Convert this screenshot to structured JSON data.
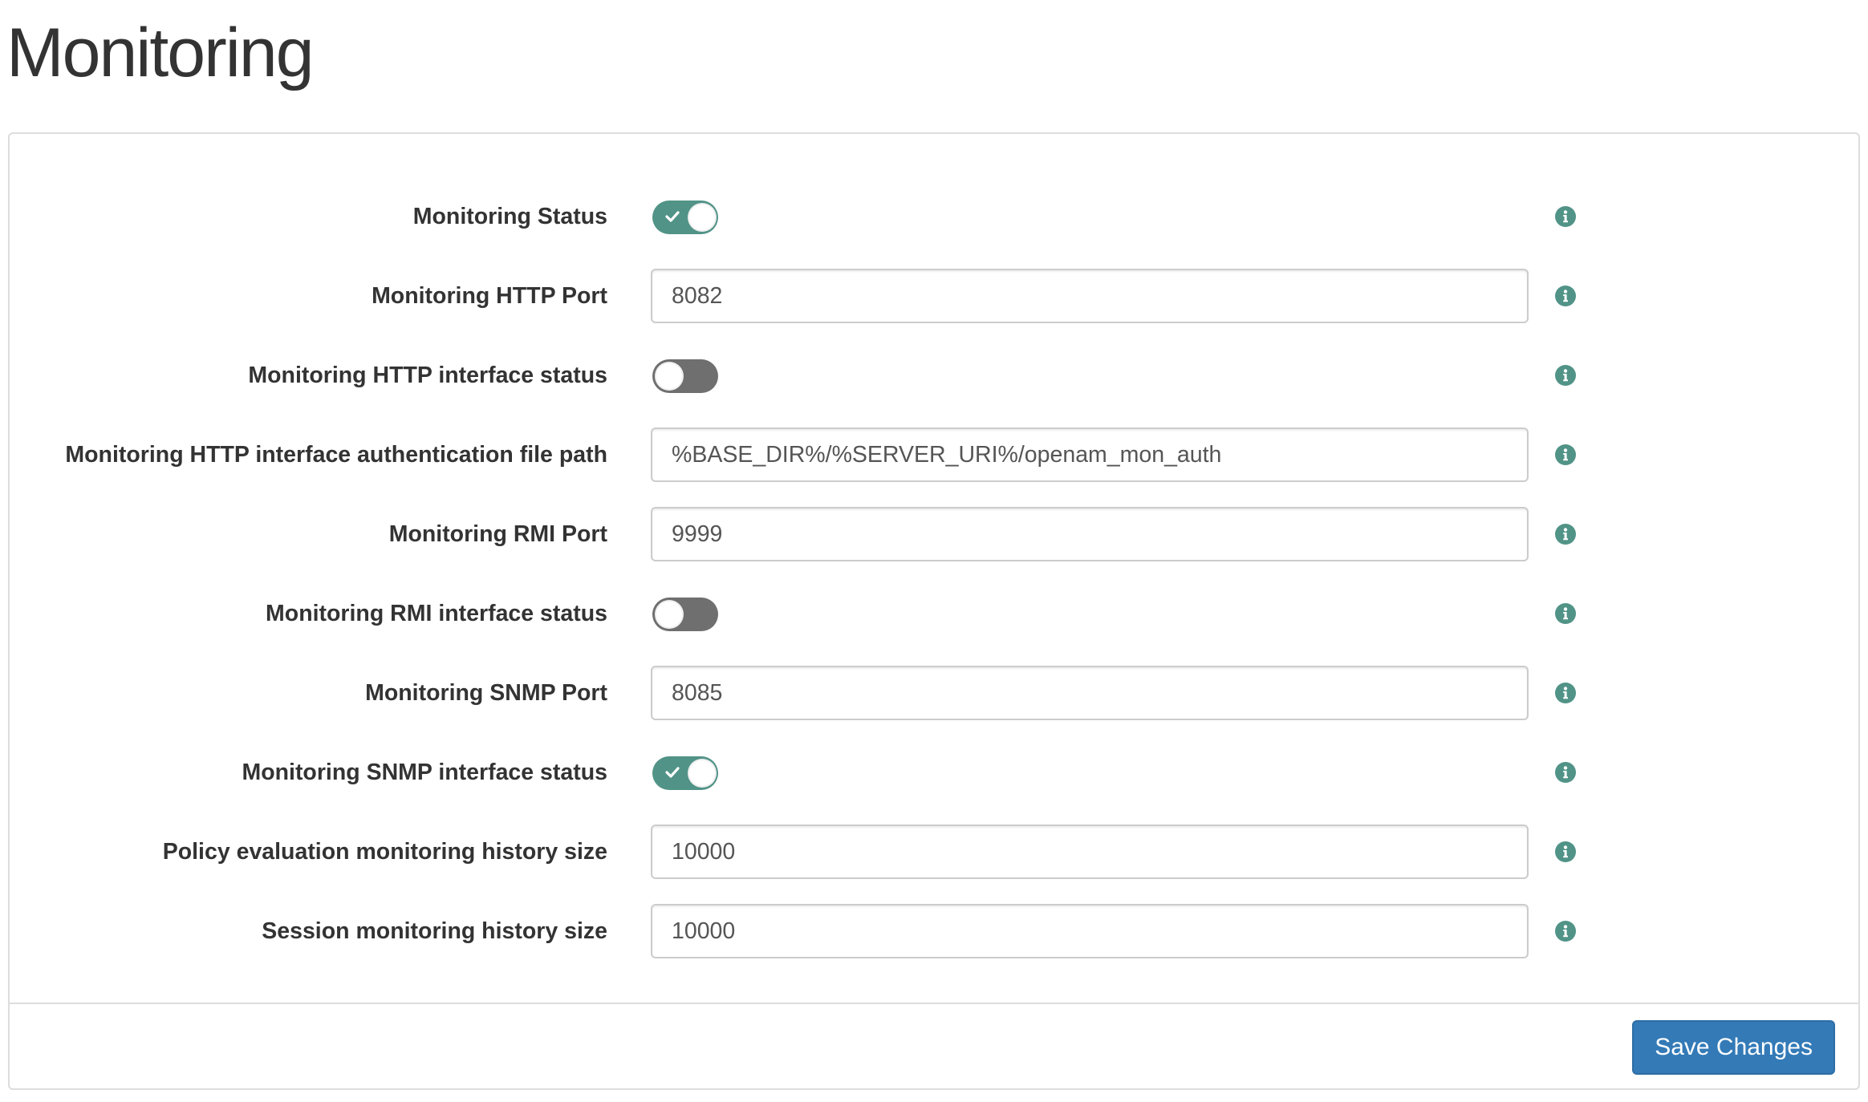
{
  "page": {
    "title": "Monitoring"
  },
  "form": {
    "rows": [
      {
        "label": "Monitoring Status",
        "type": "toggle",
        "enabled": true
      },
      {
        "label": "Monitoring HTTP Port",
        "type": "text",
        "value": "8082"
      },
      {
        "label": "Monitoring HTTP interface status",
        "type": "toggle",
        "enabled": false
      },
      {
        "label": "Monitoring HTTP interface authentication file path",
        "type": "text",
        "value": "%BASE_DIR%/%SERVER_URI%/openam_mon_auth"
      },
      {
        "label": "Monitoring RMI Port",
        "type": "text",
        "value": "9999"
      },
      {
        "label": "Monitoring RMI interface status",
        "type": "toggle",
        "enabled": false
      },
      {
        "label": "Monitoring SNMP Port",
        "type": "text",
        "value": "8085"
      },
      {
        "label": "Monitoring SNMP interface status",
        "type": "toggle",
        "enabled": true
      },
      {
        "label": "Policy evaluation monitoring history size",
        "type": "text",
        "value": "10000"
      },
      {
        "label": "Session monitoring history size",
        "type": "text",
        "value": "10000"
      }
    ]
  },
  "footer": {
    "save_label": "Save Changes"
  },
  "icons": {
    "info": "info-icon",
    "check": "check-icon"
  },
  "colors": {
    "toggle_on": "#519387",
    "toggle_off": "#6f6f6f",
    "info_icon": "#519387",
    "primary_button": "#337ab7"
  }
}
